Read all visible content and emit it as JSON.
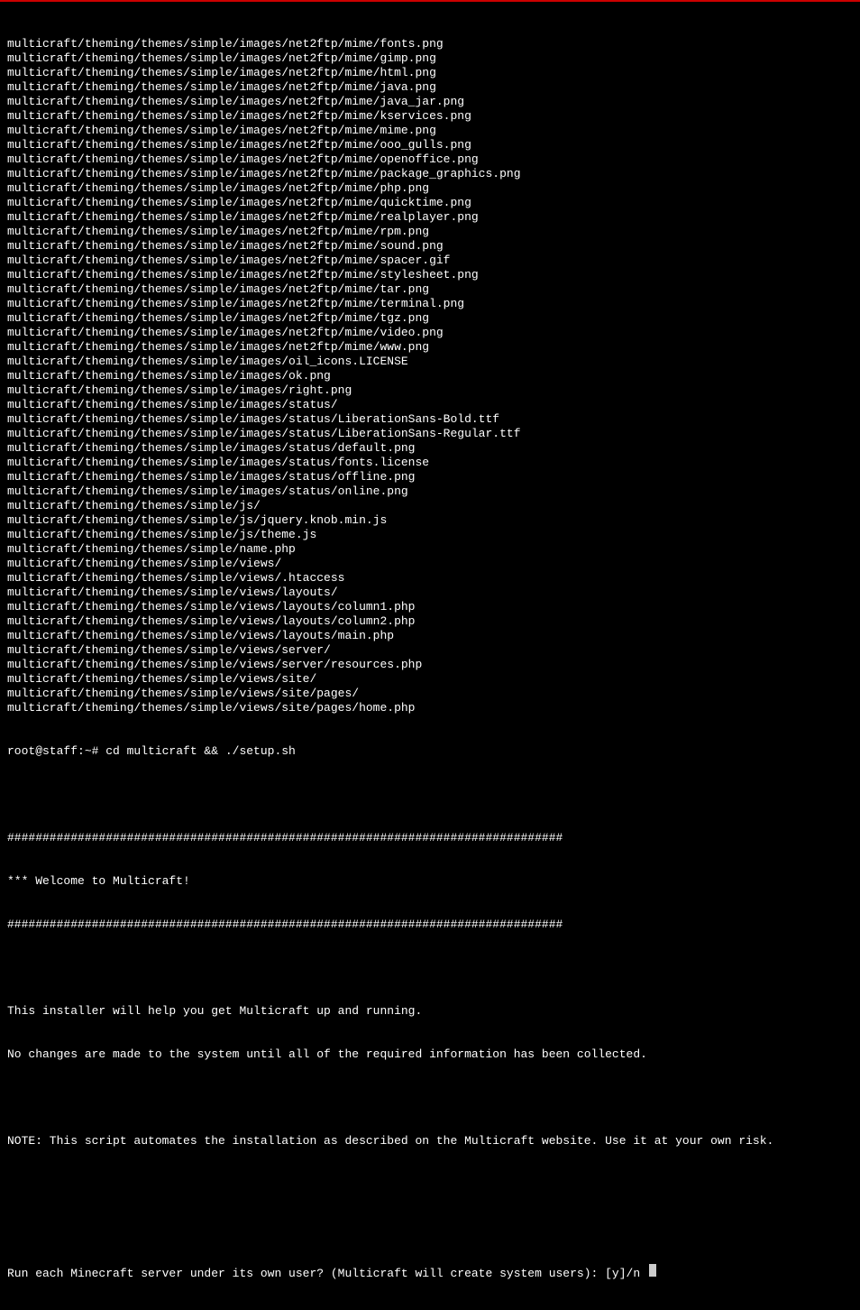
{
  "file_listing": [
    "multicraft/theming/themes/simple/images/net2ftp/mime/fonts.png",
    "multicraft/theming/themes/simple/images/net2ftp/mime/gimp.png",
    "multicraft/theming/themes/simple/images/net2ftp/mime/html.png",
    "multicraft/theming/themes/simple/images/net2ftp/mime/java.png",
    "multicraft/theming/themes/simple/images/net2ftp/mime/java_jar.png",
    "multicraft/theming/themes/simple/images/net2ftp/mime/kservices.png",
    "multicraft/theming/themes/simple/images/net2ftp/mime/mime.png",
    "multicraft/theming/themes/simple/images/net2ftp/mime/ooo_gulls.png",
    "multicraft/theming/themes/simple/images/net2ftp/mime/openoffice.png",
    "multicraft/theming/themes/simple/images/net2ftp/mime/package_graphics.png",
    "multicraft/theming/themes/simple/images/net2ftp/mime/php.png",
    "multicraft/theming/themes/simple/images/net2ftp/mime/quicktime.png",
    "multicraft/theming/themes/simple/images/net2ftp/mime/realplayer.png",
    "multicraft/theming/themes/simple/images/net2ftp/mime/rpm.png",
    "multicraft/theming/themes/simple/images/net2ftp/mime/sound.png",
    "multicraft/theming/themes/simple/images/net2ftp/mime/spacer.gif",
    "multicraft/theming/themes/simple/images/net2ftp/mime/stylesheet.png",
    "multicraft/theming/themes/simple/images/net2ftp/mime/tar.png",
    "multicraft/theming/themes/simple/images/net2ftp/mime/terminal.png",
    "multicraft/theming/themes/simple/images/net2ftp/mime/tgz.png",
    "multicraft/theming/themes/simple/images/net2ftp/mime/video.png",
    "multicraft/theming/themes/simple/images/net2ftp/mime/www.png",
    "multicraft/theming/themes/simple/images/oil_icons.LICENSE",
    "multicraft/theming/themes/simple/images/ok.png",
    "multicraft/theming/themes/simple/images/right.png",
    "multicraft/theming/themes/simple/images/status/",
    "multicraft/theming/themes/simple/images/status/LiberationSans-Bold.ttf",
    "multicraft/theming/themes/simple/images/status/LiberationSans-Regular.ttf",
    "multicraft/theming/themes/simple/images/status/default.png",
    "multicraft/theming/themes/simple/images/status/fonts.license",
    "multicraft/theming/themes/simple/images/status/offline.png",
    "multicraft/theming/themes/simple/images/status/online.png",
    "multicraft/theming/themes/simple/js/",
    "multicraft/theming/themes/simple/js/jquery.knob.min.js",
    "multicraft/theming/themes/simple/js/theme.js",
    "multicraft/theming/themes/simple/name.php",
    "multicraft/theming/themes/simple/views/",
    "multicraft/theming/themes/simple/views/.htaccess",
    "multicraft/theming/themes/simple/views/layouts/",
    "multicraft/theming/themes/simple/views/layouts/column1.php",
    "multicraft/theming/themes/simple/views/layouts/column2.php",
    "multicraft/theming/themes/simple/views/layouts/main.php",
    "multicraft/theming/themes/simple/views/server/",
    "multicraft/theming/themes/simple/views/server/resources.php",
    "multicraft/theming/themes/simple/views/site/",
    "multicraft/theming/themes/simple/views/site/pages/",
    "multicraft/theming/themes/simple/views/site/pages/home.php"
  ],
  "prompt": {
    "text": "root@staff:~# cd multicraft && ./setup.sh"
  },
  "installer": {
    "divider": "###############################################################################",
    "welcome": "*** Welcome to Multicraft!",
    "blank": "",
    "help1": "This installer will help you get Multicraft up and running.",
    "help2": "No changes are made to the system until all of the required information has been collected.",
    "note": "NOTE: This script automates the installation as described on the Multicraft website. Use it at your own risk.",
    "question": "Run each Minecraft server under its own user? (Multicraft will create system users): [y]/n "
  }
}
